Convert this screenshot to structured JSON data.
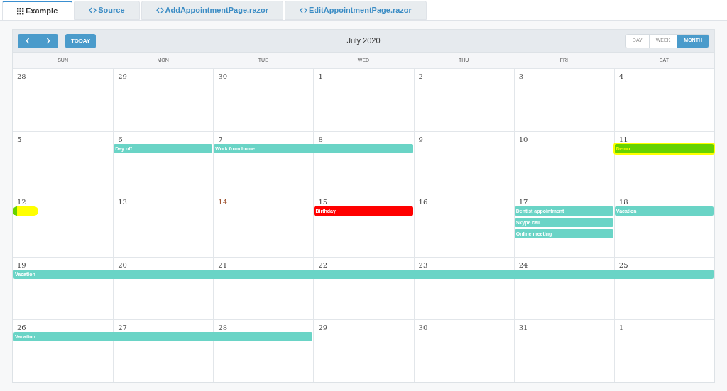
{
  "tabs": [
    {
      "label": "Example",
      "selected": true
    },
    {
      "label": "Source",
      "selected": false
    },
    {
      "label": "AddAppointmentPage.razor",
      "selected": false
    },
    {
      "label": "EditAppointmentPage.razor",
      "selected": false
    }
  ],
  "toolbar": {
    "today": "TODAY",
    "title": "July 2020",
    "views": [
      {
        "label": "DAY",
        "selected": false
      },
      {
        "label": "WEEK",
        "selected": false
      },
      {
        "label": "MONTH",
        "selected": true
      }
    ]
  },
  "weekdays": [
    "SUN",
    "MON",
    "TUE",
    "WED",
    "THU",
    "FRI",
    "SAT"
  ],
  "weeks": [
    {
      "days": [
        {
          "number": "28",
          "today": false
        },
        {
          "number": "29",
          "today": false
        },
        {
          "number": "30",
          "today": false
        },
        {
          "number": "1",
          "today": false
        },
        {
          "number": "2",
          "today": false
        },
        {
          "number": "3",
          "today": false
        },
        {
          "number": "4",
          "today": false
        }
      ]
    },
    {
      "days": [
        {
          "number": "5",
          "today": false
        },
        {
          "number": "6",
          "today": false
        },
        {
          "number": "7",
          "today": false
        },
        {
          "number": "8",
          "today": false
        },
        {
          "number": "9",
          "today": false
        },
        {
          "number": "10",
          "today": false
        },
        {
          "number": "11",
          "today": false
        }
      ],
      "lanes": [
        [
          {
            "kind": "none"
          },
          {
            "kind": "start",
            "title": "Day off",
            "color": "#6ad4c6",
            "highlighted": false
          },
          {
            "kind": "start",
            "title": "Work from home",
            "color": "#6ad4c6",
            "highlighted": false
          },
          {
            "kind": "continued"
          },
          {
            "kind": "none"
          },
          {
            "kind": "none"
          },
          {
            "kind": "start",
            "title": "Demo",
            "color": "#66d200",
            "highlighted": true
          }
        ]
      ]
    },
    {
      "days": [
        {
          "number": "12",
          "today": false
        },
        {
          "number": "13",
          "today": false
        },
        {
          "number": "14",
          "today": true
        },
        {
          "number": "15",
          "today": false
        },
        {
          "number": "16",
          "today": false
        },
        {
          "number": "17",
          "today": false
        },
        {
          "number": "18",
          "today": false
        }
      ],
      "lanes": [
        [
          {
            "kind": "start",
            "color": "#66d200",
            "highlighted": true
          },
          {
            "kind": "none"
          },
          {
            "kind": "none"
          },
          {
            "kind": "start",
            "title": "Birthday",
            "color": "#ff0000",
            "highlighted": false
          },
          {
            "kind": "none"
          },
          {
            "kind": "start",
            "title": "Dentist appointment",
            "color": "#6ad4c6",
            "highlighted": false
          },
          {
            "kind": "start",
            "title": "Vacation",
            "color": "#6ad4c6",
            "highlighted": false
          }
        ],
        [
          {
            "kind": "none"
          },
          {
            "kind": "none"
          },
          {
            "kind": "none"
          },
          {
            "kind": "none"
          },
          {
            "kind": "none"
          },
          {
            "kind": "start",
            "title": "Skype call",
            "color": "#6ad4c6",
            "highlighted": false
          },
          {
            "kind": "none"
          }
        ],
        [
          {
            "kind": "none"
          },
          {
            "kind": "none"
          },
          {
            "kind": "none"
          },
          {
            "kind": "none"
          },
          {
            "kind": "none"
          },
          {
            "kind": "start",
            "title": "Online meeting",
            "color": "#6ad4c6",
            "highlighted": false
          },
          {
            "kind": "none"
          }
        ]
      ]
    },
    {
      "days": [
        {
          "number": "19",
          "today": false
        },
        {
          "number": "20",
          "today": false
        },
        {
          "number": "21",
          "today": false
        },
        {
          "number": "22",
          "today": false
        },
        {
          "number": "23",
          "today": false
        },
        {
          "number": "24",
          "today": false
        },
        {
          "number": "25",
          "today": false
        }
      ],
      "lanes": [
        [
          {
            "kind": "start",
            "title": "Vacation",
            "color": "#6ad4c6",
            "highlighted": false
          },
          {
            "kind": "continued"
          },
          {
            "kind": "continued"
          },
          {
            "kind": "continued"
          },
          {
            "kind": "continued"
          },
          {
            "kind": "continued"
          },
          {
            "kind": "continued"
          }
        ]
      ]
    },
    {
      "days": [
        {
          "number": "26",
          "today": false
        },
        {
          "number": "27",
          "today": false
        },
        {
          "number": "28",
          "today": false
        },
        {
          "number": "29",
          "today": false
        },
        {
          "number": "30",
          "today": false
        },
        {
          "number": "31",
          "today": false
        },
        {
          "number": "1",
          "today": false
        }
      ],
      "lanes": [
        [
          {
            "kind": "start",
            "title": "Vacation",
            "color": "#6ad4c6",
            "highlighted": false
          },
          {
            "kind": "continued"
          },
          {
            "kind": "continued"
          },
          {
            "kind": "none"
          },
          {
            "kind": "none"
          },
          {
            "kind": "none"
          },
          {
            "kind": "none"
          }
        ]
      ]
    }
  ]
}
